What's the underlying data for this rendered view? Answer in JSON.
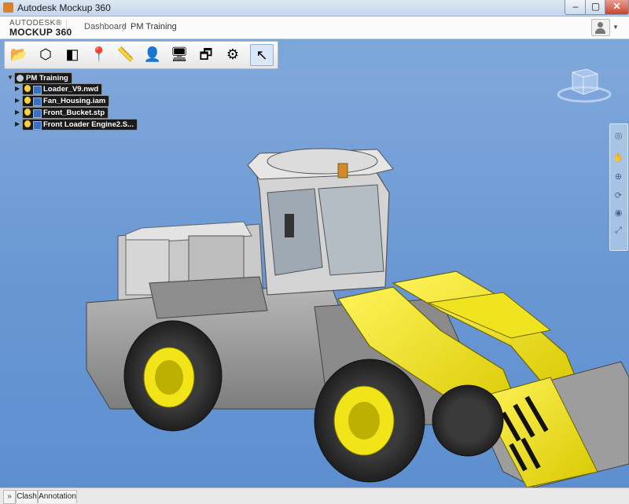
{
  "window": {
    "title": "Autodesk Mockup 360",
    "min": "–",
    "max": "▢",
    "close": "✕"
  },
  "header": {
    "brand_top": "AUTODESK®",
    "brand_bottom": "MOCKUP 360",
    "breadcrumb": [
      "Dashboard",
      "PM Training"
    ],
    "crumb_separator": "〉",
    "user_dropdown": "▼"
  },
  "toolbar": {
    "tools": [
      {
        "name": "open-icon",
        "glyph": "📂"
      },
      {
        "name": "orbit-icon",
        "glyph": "⬡"
      },
      {
        "name": "section-icon",
        "glyph": "◧"
      },
      {
        "name": "markup-icon",
        "glyph": "📍"
      },
      {
        "name": "measure-icon",
        "glyph": "📏"
      },
      {
        "name": "walkthrough-icon",
        "glyph": "👤"
      },
      {
        "name": "presenter-icon",
        "glyph": "🖥"
      },
      {
        "name": "views-icon",
        "glyph": "🗗"
      },
      {
        "name": "settings-icon",
        "glyph": "⚙"
      },
      {
        "name": "select-icon",
        "glyph": "↖"
      }
    ],
    "active_index": 9
  },
  "tree": {
    "root": "PM Training",
    "items": [
      "Loader_V9.nwd",
      "Fan_Housing.iam",
      "Front_Bucket.stp",
      "Front Loader Engine2.S..."
    ]
  },
  "navbar": {
    "buttons": [
      {
        "name": "steering-wheel-icon",
        "glyph": "◎"
      },
      {
        "name": "pan-icon",
        "glyph": "✋"
      },
      {
        "name": "zoom-icon",
        "glyph": "⊕"
      },
      {
        "name": "orbit-nav-icon",
        "glyph": "⟳"
      },
      {
        "name": "look-icon",
        "glyph": "◉"
      },
      {
        "name": "fit-icon",
        "glyph": "⤢"
      }
    ]
  },
  "bottom": {
    "expand": "»",
    "tabs": [
      "Clash",
      "Annotation"
    ]
  },
  "colors": {
    "viewport": "#6a97d3",
    "accent": "#f5e612",
    "body": "#9a9a9a"
  }
}
